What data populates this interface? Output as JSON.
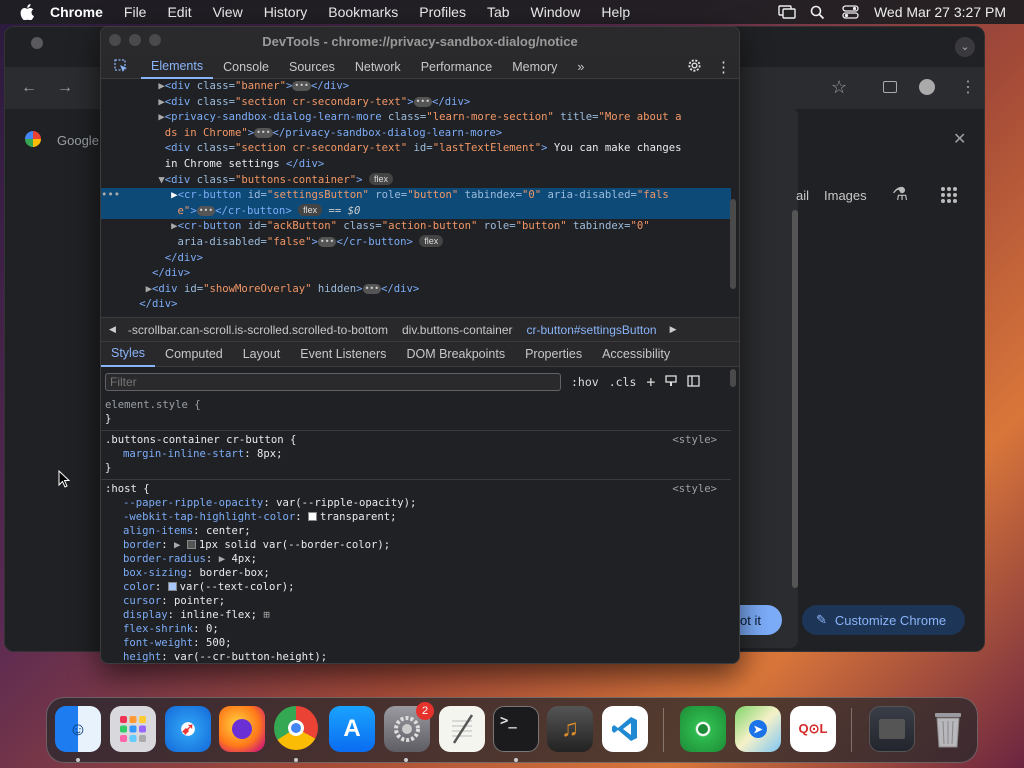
{
  "menubar": {
    "app": "Chrome",
    "items": [
      "File",
      "Edit",
      "View",
      "History",
      "Bookmarks",
      "Profiles",
      "Tab",
      "Window",
      "Help"
    ],
    "datetime": "Wed Mar 27  3:27 PM"
  },
  "background_browser": {
    "google_tab": "Google",
    "gmail_fragment": "ail",
    "images_link": "Images",
    "got_it_fragment": "ot it",
    "customize_button": "Customize Chrome"
  },
  "devtools": {
    "title": "DevTools - chrome://privacy-sandbox-dialog/notice",
    "tabs": [
      "Elements",
      "Console",
      "Sources",
      "Network",
      "Performance",
      "Memory"
    ],
    "more_tabs": "»",
    "breadcrumb": [
      "-scrollbar.can-scroll.is-scrolled.scrolled-to-bottom",
      "div.buttons-container",
      "cr-button#settingsButton"
    ],
    "styles_tabs": [
      "Styles",
      "Computed",
      "Layout",
      "Event Listeners",
      "DOM Breakpoints",
      "Properties",
      "Accessibility"
    ],
    "filter_placeholder": "Filter",
    "hov": ":hov",
    "cls": ".cls",
    "elements": {
      "l1a": "<div",
      "l1b": " class=",
      "l1c": "\"banner\"",
      "l1d": ">",
      "l1e": "</div>",
      "l2a": "<div",
      "l2b": " class=",
      "l2c": "\"section cr-secondary-text\"",
      "l2d": ">",
      "l2e": "</div>",
      "l3a": "<privacy-sandbox-dialog-learn-more",
      "l3b": " class=",
      "l3c": "\"learn-more-section\"",
      "l3d": " title=",
      "l3e": "\"More about a",
      "l4a": "ds in Chrome\"",
      "l4b": ">",
      "l4c": "</privacy-sandbox-dialog-learn-more>",
      "l5a": "<div",
      "l5b": " class=",
      "l5c": "\"section cr-secondary-text\"",
      "l5d": " id=",
      "l5e": "\"lastTextElement\"",
      "l5f": ">",
      "l5g": " You can make changes",
      "l6a": "in Chrome settings ",
      "l6b": "</div>",
      "l7a": "<div",
      "l7b": " class=",
      "l7c": "\"buttons-container\"",
      "l7d": ">",
      "l7badge": "flex",
      "l8a": "<cr-button",
      "l8b": " id=",
      "l8c": "\"settingsButton\"",
      "l8d": " role=",
      "l8e": "\"button\"",
      "l8f": " tabindex=",
      "l8g": "\"0\"",
      "l8h": " aria-disabled=",
      "l8i": "\"fals",
      "l9a": "e\"",
      "l9b": ">",
      "l9c": "</cr-button>",
      "l9badge": "flex",
      "l9d": " == $0",
      "l10a": "<cr-button",
      "l10b": " id=",
      "l10c": "\"ackButton\"",
      "l10d": " class=",
      "l10e": "\"action-button\"",
      "l10f": " role=",
      "l10g": "\"button\"",
      "l10h": " tabindex=",
      "l10i": "\"0\"",
      "l11a": "aria-disabled=",
      "l11b": "\"false\"",
      "l11c": ">",
      "l11d": "</cr-button>",
      "l11badge": "flex",
      "l12": "</div>",
      "l13": "</div>",
      "l14a": "<div",
      "l14b": " id=",
      "l14c": "\"showMoreOverlay\"",
      "l14d": " hidden",
      "l14e": ">",
      "l14f": "</div>",
      "l15": "</div>"
    },
    "styles": {
      "r1_selector": "element.style {",
      "close": "}",
      "r2_selector": ".buttons-container cr-button {",
      "r2_source": "<style>",
      "r2_props": [
        {
          "name": "margin-inline-start",
          "value": "8px;"
        }
      ],
      "r3_selector": ":host {",
      "r3_source": "<style>",
      "r3_props": [
        {
          "name": "--paper-ripple-opacity",
          "value": "var(--ripple-opacity);"
        },
        {
          "name": "-webkit-tap-highlight-color",
          "value": "transparent;"
        },
        {
          "name": "align-items",
          "value": "center;"
        },
        {
          "name": "border",
          "value": "1px solid var(--border-color);"
        },
        {
          "name": "border-radius",
          "value": "4px;"
        },
        {
          "name": "box-sizing",
          "value": "border-box;"
        },
        {
          "name": "color",
          "value": "var(--text-color);"
        },
        {
          "name": "cursor",
          "value": "pointer;"
        },
        {
          "name": "display",
          "value": "inline-flex;"
        },
        {
          "name": "flex-shrink",
          "value": "0;"
        },
        {
          "name": "font-weight",
          "value": "500;"
        },
        {
          "name": "height",
          "value": "var(--cr-button-height);"
        }
      ]
    }
  },
  "dock": {
    "settings_badge": "2",
    "terminal_label": ">_",
    "qol_label": "Q⊙L"
  }
}
